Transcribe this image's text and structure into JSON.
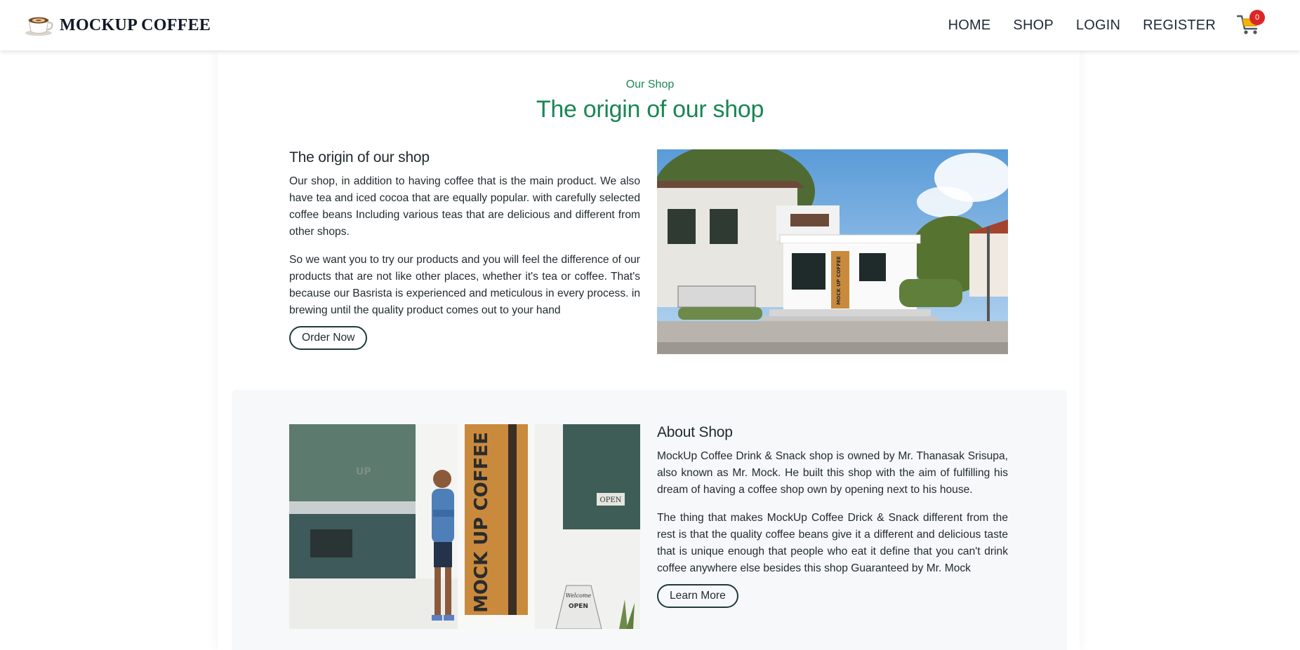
{
  "brand": {
    "name": "MOCKUP COFFEE",
    "logo_icon": "coffee-cup-icon"
  },
  "nav": {
    "items": [
      {
        "label": "HOME"
      },
      {
        "label": "SHOP"
      },
      {
        "label": "LOGIN"
      },
      {
        "label": "REGISTER"
      }
    ],
    "cart_icon": "shopping-cart-icon",
    "cart_count": "0"
  },
  "header": {
    "eyebrow": "Our Shop",
    "title": "The origin of our shop"
  },
  "origin": {
    "heading": "The origin of our shop",
    "paragraphs": [
      "Our shop, in addition to having coffee that is the main product. We also have tea and iced cocoa that are equally popular. with carefully selected coffee beans Including various teas that are delicious and different from other shops.",
      "So we want you to try our products and you will feel the difference of our products that are not like other places, whether it's tea or coffee. That's because our Basrista is experienced and meticulous in every process. in brewing until the quality product comes out to your hand"
    ],
    "button": "Order Now",
    "image_sign_text": "MOCK UP COFFEE"
  },
  "about": {
    "heading": "About Shop",
    "paragraphs": [
      "MockUp Coffee Drink & Snack shop is owned by Mr. Thanasak Srisupa, also known as Mr. Mock. He built this shop with the aim of fulfilling his dream of having a coffee shop own by opening next to his house.",
      "The thing that makes MockUp Coffee Drick & Snack different from the rest is that the quality coffee beans give it a different and delicious taste that is unique enough that people who eat it define that you can't drink coffee anywhere else besides this shop Guaranteed by Mr. Mock"
    ],
    "button": "Learn More",
    "image_sign_text": "MOCK UP COFFEE",
    "image_open_sign": "OPEN",
    "image_welcome_sign": "Welcome",
    "image_window_text": "UP"
  },
  "colors": {
    "accent_green": "#198754",
    "badge_red": "#dc2626",
    "cart_yellow": "#f5b400",
    "door_wood": "#c98a3e"
  }
}
